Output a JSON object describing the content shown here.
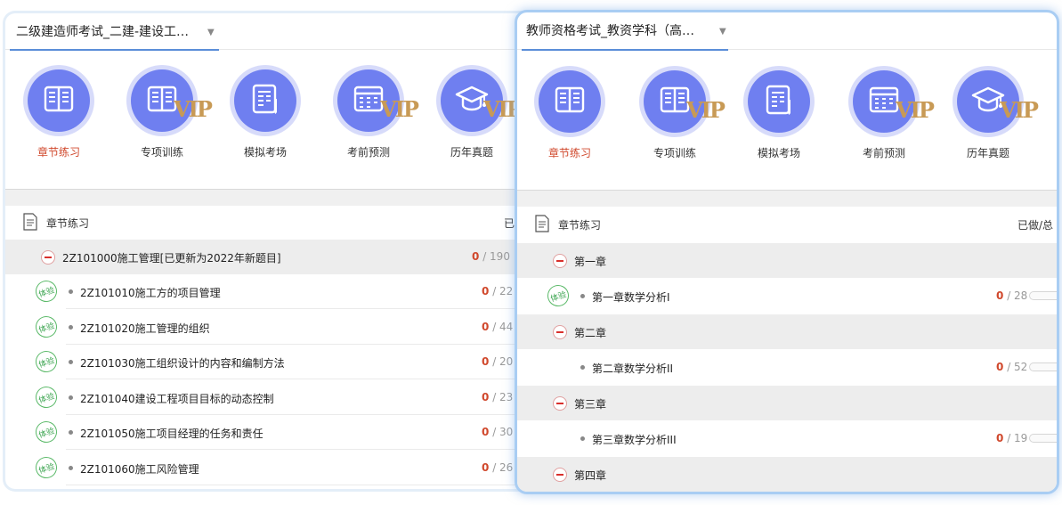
{
  "panel_left": {
    "select_text": "二级建造师考试_二建-建设工…",
    "icons": [
      {
        "label": "章节练习",
        "icon": "book-icon",
        "vip": false,
        "active": true
      },
      {
        "label": "专项训练",
        "icon": "book-icon",
        "vip": true,
        "active": false
      },
      {
        "label": "模拟考场",
        "icon": "exam-paper-icon",
        "vip": false,
        "active": false
      },
      {
        "label": "考前预测",
        "icon": "calendar-grid-icon",
        "vip": true,
        "active": false
      },
      {
        "label": "历年真题",
        "icon": "graduation-cap-icon",
        "vip": true,
        "active": false
      }
    ],
    "section_title": "章节练习",
    "section_right": "已",
    "chapter": {
      "title": "2Z101000施工管理[已更新为2022年新题目]",
      "done": "0",
      "total": "/ 190"
    },
    "items": [
      {
        "badge": "体验",
        "title": "2Z101010施工方的项目管理",
        "done": "0",
        "total": "/ 22"
      },
      {
        "badge": "体验",
        "title": "2Z101020施工管理的组织",
        "done": "0",
        "total": "/ 44"
      },
      {
        "badge": "体验",
        "title": "2Z101030施工组织设计的内容和编制方法",
        "done": "0",
        "total": "/ 20"
      },
      {
        "badge": "体验",
        "title": "2Z101040建设工程项目目标的动态控制",
        "done": "0",
        "total": "/ 23"
      },
      {
        "badge": "体验",
        "title": "2Z101050施工项目经理的任务和责任",
        "done": "0",
        "total": "/ 30"
      },
      {
        "badge": "体验",
        "title": "2Z101060施工风险管理",
        "done": "0",
        "total": "/ 26"
      }
    ]
  },
  "panel_right": {
    "select_text": "教师资格考试_教资学科（高…",
    "icons": [
      {
        "label": "章节练习",
        "icon": "book-icon",
        "vip": false,
        "active": true
      },
      {
        "label": "专项训练",
        "icon": "book-icon",
        "vip": true,
        "active": false
      },
      {
        "label": "模拟考场",
        "icon": "exam-paper-icon",
        "vip": false,
        "active": false
      },
      {
        "label": "考前预测",
        "icon": "calendar-grid-icon",
        "vip": true,
        "active": false
      },
      {
        "label": "历年真题",
        "icon": "graduation-cap-icon",
        "vip": true,
        "active": false
      }
    ],
    "section_title": "章节练习",
    "section_right": "已做/总",
    "rows": [
      {
        "kind": "chapter",
        "title": "第一章"
      },
      {
        "kind": "item",
        "badge": "体验",
        "title": "第一章数学分析I",
        "done": "0",
        "total": "/ 28"
      },
      {
        "kind": "chapter",
        "title": "第二章"
      },
      {
        "kind": "item",
        "badge": "",
        "title": "第二章数学分析II",
        "done": "0",
        "total": "/ 52"
      },
      {
        "kind": "chapter",
        "title": "第三章"
      },
      {
        "kind": "item",
        "badge": "",
        "title": "第三章数学分析III",
        "done": "0",
        "total": "/ 19"
      },
      {
        "kind": "chapter",
        "title": "第四章"
      }
    ]
  },
  "vip_text": "VIP",
  "colors": {
    "icon_blue": "#6f7ff0",
    "active_red": "#d0482c",
    "badge_green": "#3fa653",
    "vip_gold": "#c89a55"
  }
}
